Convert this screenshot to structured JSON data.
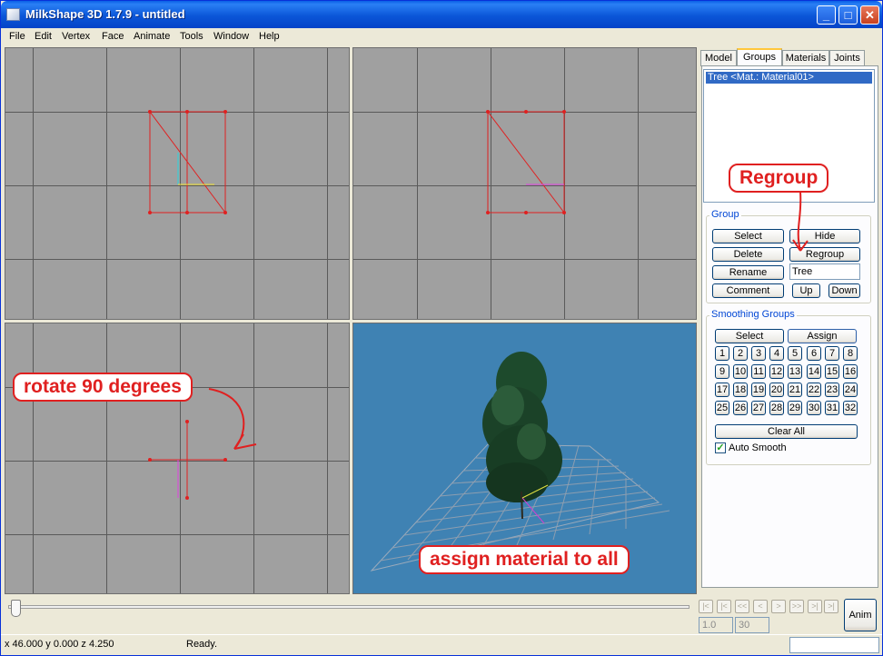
{
  "window": {
    "title": "MilkShape 3D 1.7.9 - untitled",
    "controls": {
      "minimize": "_",
      "maximize": "□",
      "close": "✕"
    }
  },
  "menu": [
    "File",
    "Edit",
    "Vertex",
    "Face",
    "Animate",
    "Tools",
    "Window",
    "Help"
  ],
  "tabs": [
    "Model",
    "Groups",
    "Materials",
    "Joints"
  ],
  "active_tab": "Groups",
  "groups_list": [
    "Tree <Mat.: Material01>"
  ],
  "group_section": {
    "label": "Group",
    "select": "Select",
    "hide": "Hide",
    "delete": "Delete",
    "regroup": "Regroup",
    "rename": "Rename",
    "name_value": "Tree",
    "comment": "Comment",
    "up": "Up",
    "down": "Down"
  },
  "smoothing": {
    "label": "Smoothing Groups",
    "select": "Select",
    "assign": "Assign",
    "numbers": [
      "1",
      "2",
      "3",
      "4",
      "5",
      "6",
      "7",
      "8",
      "9",
      "10",
      "11",
      "12",
      "13",
      "14",
      "15",
      "16",
      "17",
      "18",
      "19",
      "20",
      "21",
      "22",
      "23",
      "24",
      "25",
      "26",
      "27",
      "28",
      "29",
      "30",
      "31",
      "32"
    ],
    "clear_all": "Clear All",
    "auto_smooth_label": "Auto Smooth",
    "auto_smooth_checked": true
  },
  "annotations": {
    "regroup": "Regroup",
    "rotate": "rotate 90 degrees",
    "assign": "assign material to all"
  },
  "timeline": {
    "nav_buttons": [
      "|<",
      "|<",
      "<<",
      "<",
      ">",
      ">>",
      ">|",
      ">|"
    ],
    "start_frame": "1.0",
    "end_frame": "30",
    "anim_label": "Anim"
  },
  "status": {
    "coords": "x 46.000 y 0.000 z 4.250",
    "message": "Ready."
  },
  "colors": {
    "viewport_gray": "#a0a0a0",
    "viewport_3d": "#3f82b3",
    "wire_red": "#e02020",
    "annotation_red": "#e02020",
    "selection_blue": "#316ac5"
  }
}
